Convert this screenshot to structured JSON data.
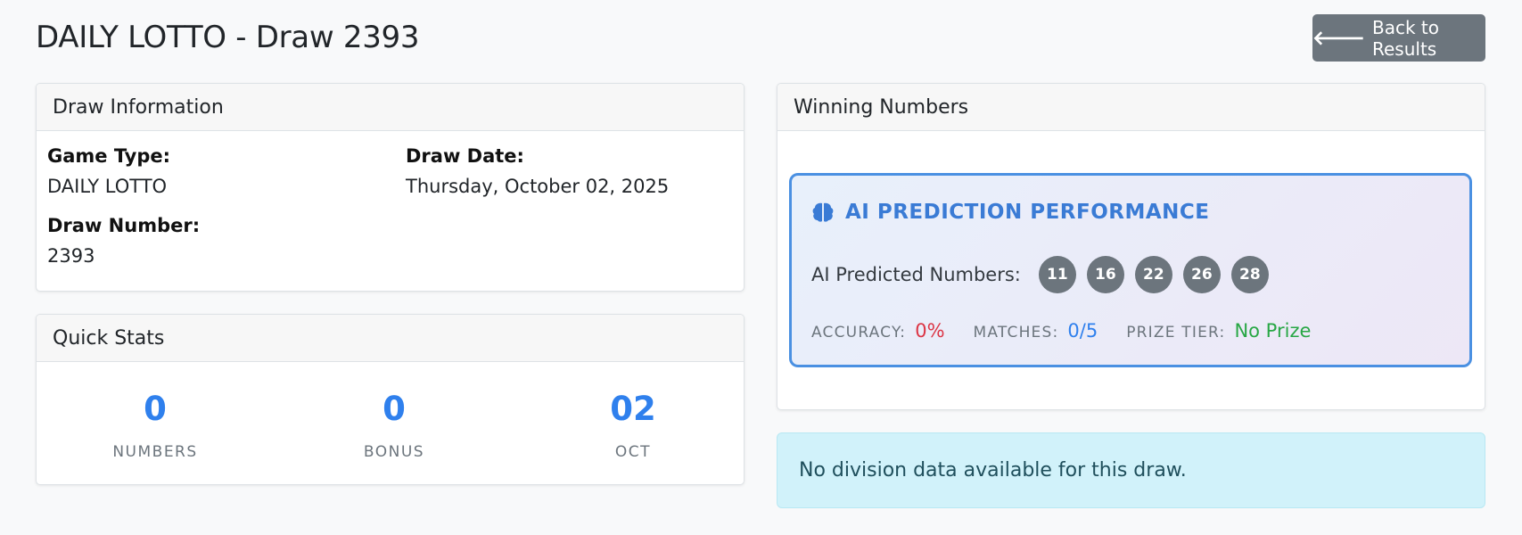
{
  "header": {
    "title": "DAILY LOTTO - Draw 2393",
    "back_label": "Back to Results"
  },
  "draw_info": {
    "heading": "Draw Information",
    "game_type_label": "Game Type:",
    "game_type_value": "DAILY LOTTO",
    "draw_date_label": "Draw Date:",
    "draw_date_value": "Thursday, October 02, 2025",
    "draw_number_label": "Draw Number:",
    "draw_number_value": "2393"
  },
  "quick_stats": {
    "heading": "Quick Stats",
    "stats": [
      {
        "value": "0",
        "label": "NUMBERS"
      },
      {
        "value": "0",
        "label": "BONUS"
      },
      {
        "value": "02",
        "label": "OCT"
      }
    ]
  },
  "winning": {
    "heading": "Winning Numbers",
    "ai": {
      "title": "AI PREDICTION PERFORMANCE",
      "icon": "brain-icon",
      "predicted_label": "AI Predicted Numbers:",
      "numbers": [
        "11",
        "16",
        "22",
        "26",
        "28"
      ],
      "accuracy_label": "ACCURACY:",
      "accuracy_value": "0%",
      "matches_label": "MATCHES:",
      "matches_value": "0/5",
      "prize_label": "PRIZE TIER:",
      "prize_value": "No Prize"
    }
  },
  "alert": {
    "text": "No division data available for this draw."
  },
  "colors": {
    "accent_blue": "#2f80ed",
    "ai_border": "#4a90e2",
    "ball": "#6c757d",
    "alert_bg": "#d1f2fa",
    "accuracy": "#dc3545",
    "prize": "#28a745"
  }
}
